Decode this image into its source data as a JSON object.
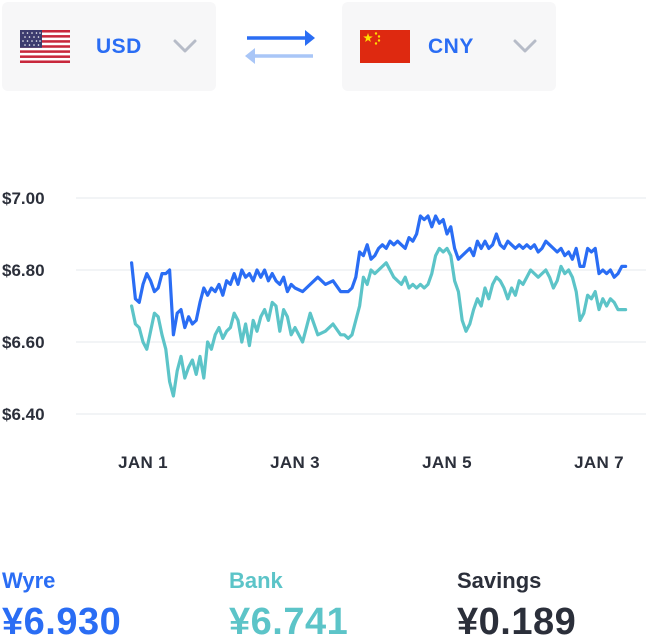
{
  "from_currency": {
    "code": "USD",
    "flag": "us-flag"
  },
  "to_currency": {
    "code": "CNY",
    "flag": "cn-flag"
  },
  "colors": {
    "accent": "#2a6df4",
    "bank": "#5cc4c8",
    "dark": "#2b2f3a",
    "swap_light": "#a9c6f7"
  },
  "chart_data": {
    "type": "line",
    "title": "",
    "xlabel": "",
    "ylabel": "",
    "x_ticks": [
      {
        "label": "JAN 1",
        "day": 1
      },
      {
        "label": "JAN 3",
        "day": 3
      },
      {
        "label": "JAN 5",
        "day": 5
      },
      {
        "label": "JAN 7",
        "day": 7
      }
    ],
    "y_ticks": [
      {
        "label": "$6.40",
        "value": 6.4
      },
      {
        "label": "$6.60",
        "value": 6.6
      },
      {
        "label": "$6.80",
        "value": 6.8
      },
      {
        "label": "$7.00",
        "value": 7.0
      }
    ],
    "xlim": [
      0.85,
      7.45
    ],
    "ylim": [
      6.35,
      7.05
    ],
    "grid": true,
    "x": [
      0.85,
      0.9,
      0.95,
      1.0,
      1.05,
      1.1,
      1.15,
      1.2,
      1.25,
      1.3,
      1.35,
      1.4,
      1.45,
      1.5,
      1.55,
      1.6,
      1.65,
      1.7,
      1.75,
      1.8,
      1.85,
      1.9,
      1.95,
      2.0,
      2.05,
      2.1,
      2.15,
      2.2,
      2.25,
      2.3,
      2.35,
      2.4,
      2.45,
      2.5,
      2.55,
      2.6,
      2.65,
      2.7,
      2.75,
      2.8,
      2.85,
      2.9,
      2.95,
      3.0,
      3.1,
      3.2,
      3.3,
      3.4,
      3.5,
      3.6,
      3.65,
      3.7,
      3.75,
      3.8,
      3.85,
      3.9,
      3.95,
      4.0,
      4.05,
      4.1,
      4.15,
      4.2,
      4.25,
      4.3,
      4.35,
      4.4,
      4.45,
      4.5,
      4.55,
      4.6,
      4.65,
      4.7,
      4.75,
      4.8,
      4.85,
      4.9,
      4.95,
      5.0,
      5.05,
      5.1,
      5.15,
      5.2,
      5.25,
      5.3,
      5.35,
      5.4,
      5.45,
      5.5,
      5.55,
      5.6,
      5.65,
      5.7,
      5.75,
      5.8,
      5.85,
      5.9,
      5.95,
      6.0,
      6.05,
      6.1,
      6.15,
      6.2,
      6.25,
      6.3,
      6.35,
      6.4,
      6.45,
      6.5,
      6.55,
      6.6,
      6.65,
      6.7,
      6.75,
      6.8,
      6.85,
      6.9,
      6.95,
      7.0,
      7.05,
      7.1,
      7.15,
      7.2,
      7.25,
      7.3,
      7.35,
      7.4
    ],
    "series": [
      {
        "name": "Wyre",
        "color": "#2a6df4",
        "values": [
          6.82,
          6.72,
          6.71,
          6.76,
          6.79,
          6.77,
          6.74,
          6.75,
          6.79,
          6.79,
          6.8,
          6.62,
          6.68,
          6.69,
          6.64,
          6.67,
          6.65,
          6.66,
          6.71,
          6.75,
          6.73,
          6.75,
          6.74,
          6.76,
          6.73,
          6.77,
          6.76,
          6.79,
          6.76,
          6.8,
          6.78,
          6.79,
          6.77,
          6.8,
          6.78,
          6.8,
          6.77,
          6.79,
          6.77,
          6.76,
          6.78,
          6.74,
          6.76,
          6.75,
          6.74,
          6.76,
          6.78,
          6.76,
          6.77,
          6.74,
          6.74,
          6.74,
          6.75,
          6.78,
          6.85,
          6.84,
          6.87,
          6.83,
          6.84,
          6.86,
          6.87,
          6.86,
          6.88,
          6.87,
          6.88,
          6.87,
          6.86,
          6.89,
          6.88,
          6.9,
          6.95,
          6.94,
          6.95,
          6.92,
          6.95,
          6.93,
          6.94,
          6.9,
          6.92,
          6.86,
          6.83,
          6.84,
          6.85,
          6.86,
          6.84,
          6.88,
          6.86,
          6.88,
          6.86,
          6.87,
          6.9,
          6.87,
          6.86,
          6.88,
          6.87,
          6.86,
          6.87,
          6.86,
          6.87,
          6.86,
          6.87,
          6.85,
          6.86,
          6.88,
          6.87,
          6.86,
          6.85,
          6.86,
          6.84,
          6.85,
          6.83,
          6.86,
          6.81,
          6.81,
          6.86,
          6.85,
          6.86,
          6.79,
          6.8,
          6.79,
          6.8,
          6.78,
          6.79,
          6.81,
          6.81
        ]
      },
      {
        "name": "Bank",
        "color": "#5cc4c8",
        "values": [
          6.7,
          6.65,
          6.64,
          6.6,
          6.58,
          6.63,
          6.68,
          6.67,
          6.62,
          6.58,
          6.49,
          6.45,
          6.52,
          6.56,
          6.5,
          6.53,
          6.55,
          6.51,
          6.56,
          6.5,
          6.6,
          6.58,
          6.62,
          6.64,
          6.61,
          6.63,
          6.64,
          6.68,
          6.66,
          6.6,
          6.65,
          6.59,
          6.66,
          6.63,
          6.67,
          6.69,
          6.66,
          6.71,
          6.7,
          6.63,
          6.69,
          6.67,
          6.62,
          6.64,
          6.6,
          6.68,
          6.62,
          6.63,
          6.65,
          6.62,
          6.62,
          6.61,
          6.62,
          6.66,
          6.7,
          6.78,
          6.76,
          6.8,
          6.79,
          6.8,
          6.81,
          6.82,
          6.8,
          6.78,
          6.77,
          6.76,
          6.78,
          6.75,
          6.76,
          6.75,
          6.76,
          6.75,
          6.76,
          6.79,
          6.84,
          6.86,
          6.85,
          6.86,
          6.84,
          6.77,
          6.74,
          6.66,
          6.63,
          6.65,
          6.69,
          6.72,
          6.7,
          6.75,
          6.72,
          6.76,
          6.78,
          6.77,
          6.75,
          6.72,
          6.75,
          6.73,
          6.77,
          6.76,
          6.78,
          6.8,
          6.79,
          6.78,
          6.79,
          6.8,
          6.78,
          6.75,
          6.77,
          6.81,
          6.79,
          6.8,
          6.78,
          6.74,
          6.66,
          6.68,
          6.73,
          6.72,
          6.74,
          6.69,
          6.72,
          6.7,
          6.72,
          6.71,
          6.69,
          6.69,
          6.69
        ]
      }
    ]
  },
  "stats": {
    "wyre": {
      "label": "Wyre",
      "value": "¥6.930"
    },
    "bank": {
      "label": "Bank",
      "value": "¥6.741"
    },
    "savings": {
      "label": "Savings",
      "value": "¥0.189"
    }
  }
}
